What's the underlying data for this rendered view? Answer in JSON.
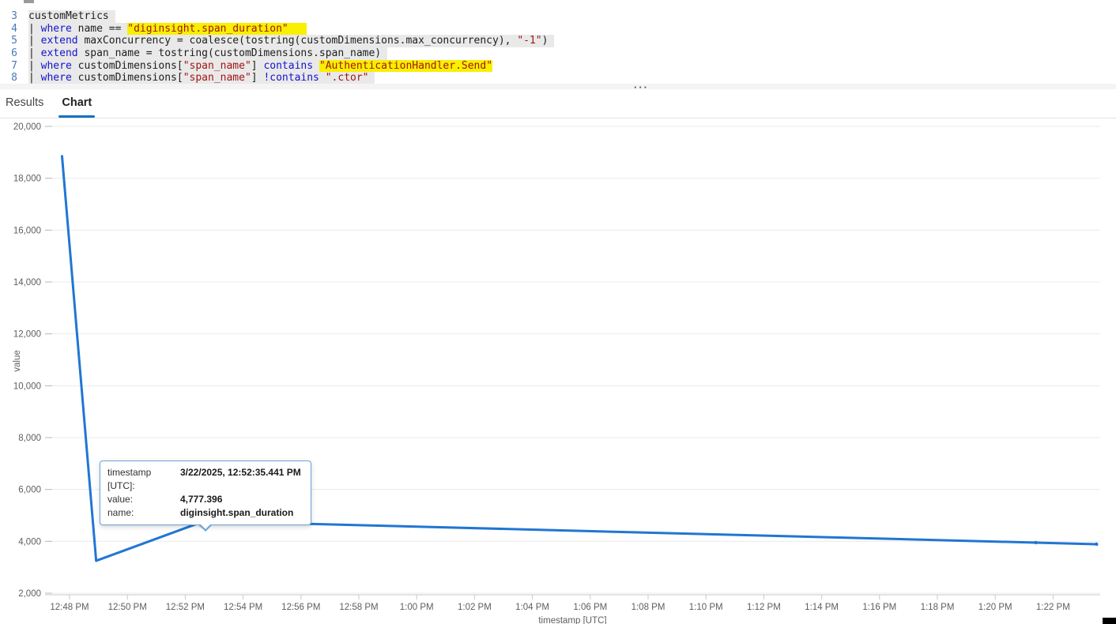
{
  "editor": {
    "lines": [
      {
        "num": "3",
        "tokens": [
          {
            "t": "customMetrics ",
            "c": "pl"
          }
        ]
      },
      {
        "num": "4",
        "tokens": [
          {
            "t": "| ",
            "c": "pl"
          },
          {
            "t": "where",
            "c": "kw"
          },
          {
            "t": " name == ",
            "c": "pl"
          },
          {
            "t": "\"diginsight.span_duration\"",
            "c": "str",
            "hl": true
          },
          {
            "t": "   ",
            "c": "pl",
            "hl": true
          }
        ]
      },
      {
        "num": "5",
        "tokens": [
          {
            "t": "| ",
            "c": "pl"
          },
          {
            "t": "extend",
            "c": "kw"
          },
          {
            "t": " maxConcurrency = coalesce(tostring(customDimensions.max_concurrency), ",
            "c": "pl"
          },
          {
            "t": "\"-1\"",
            "c": "str"
          },
          {
            "t": ") ",
            "c": "pl"
          }
        ]
      },
      {
        "num": "6",
        "tokens": [
          {
            "t": "| ",
            "c": "pl"
          },
          {
            "t": "extend",
            "c": "kw"
          },
          {
            "t": " span_name = tostring(customDimensions.span_name) ",
            "c": "pl"
          }
        ]
      },
      {
        "num": "7",
        "tokens": [
          {
            "t": "| ",
            "c": "pl"
          },
          {
            "t": "where",
            "c": "kw"
          },
          {
            "t": " customDimensions[",
            "c": "pl"
          },
          {
            "t": "\"span_name\"",
            "c": "str"
          },
          {
            "t": "] ",
            "c": "pl"
          },
          {
            "t": "contains",
            "c": "kw"
          },
          {
            "t": " ",
            "c": "pl"
          },
          {
            "t": "\"AuthenticationHandler.Send\"",
            "c": "str",
            "hl": true
          }
        ]
      },
      {
        "num": "8",
        "tokens": [
          {
            "t": "| ",
            "c": "pl"
          },
          {
            "t": "where",
            "c": "kw"
          },
          {
            "t": " customDimensions[",
            "c": "pl"
          },
          {
            "t": "\"span_name\"",
            "c": "str"
          },
          {
            "t": "] ",
            "c": "pl"
          },
          {
            "t": "!contains",
            "c": "kw"
          },
          {
            "t": " ",
            "c": "pl"
          },
          {
            "t": "\".ctor\"",
            "c": "str"
          },
          {
            "t": " ",
            "c": "pl"
          }
        ]
      }
    ]
  },
  "splitter": {
    "handle": "···"
  },
  "tabs": [
    {
      "label": "Results",
      "active": false
    },
    {
      "label": "Chart",
      "active": true
    }
  ],
  "tooltip": {
    "rows": [
      {
        "label": "timestamp [UTC]:",
        "value": "3/22/2025, 12:52:35.441 PM"
      },
      {
        "label": "value:",
        "value": "4,777.396"
      },
      {
        "label": "name:",
        "value": "diginsight.span_duration"
      }
    ]
  },
  "chart_data": {
    "type": "line",
    "series_name": "diginsight.span_duration",
    "ylabel": "value",
    "xlabel": "timestamp [UTC]",
    "ylim": [
      2000,
      20000
    ],
    "ytick_step": 2000,
    "x_tick_interval_minutes": 2,
    "x_tick_labels": [
      "12:48 PM",
      "12:50 PM",
      "12:52 PM",
      "12:54 PM",
      "12:56 PM",
      "12:58 PM",
      "1:00 PM",
      "1:02 PM",
      "1:04 PM",
      "1:06 PM",
      "1:08 PM",
      "1:10 PM",
      "1:12 PM",
      "1:14 PM",
      "1:16 PM",
      "1:18 PM",
      "1:20 PM",
      "1:22 PM"
    ],
    "points": [
      {
        "x_min_after_1248pm": -0.26,
        "value": 18850
      },
      {
        "x_min_after_1248pm": 0.92,
        "value": 3250
      },
      {
        "x_min_after_1248pm": 4.65,
        "value": 4777.396
      },
      {
        "x_min_after_1248pm": 33.4,
        "value": 3950,
        "dot": true
      },
      {
        "x_min_after_1248pm": 35.5,
        "value": 3890,
        "dot": true
      }
    ],
    "highlighted_point_index": 2,
    "line_color": "#2176d2",
    "grid": true,
    "colors": {
      "accent": "#1371c3",
      "highlight_yellow": "#f9ef00",
      "selection_gray": "#e9e9e9",
      "string_red": "#a31515",
      "keyword_blue": "#1414cd"
    }
  }
}
